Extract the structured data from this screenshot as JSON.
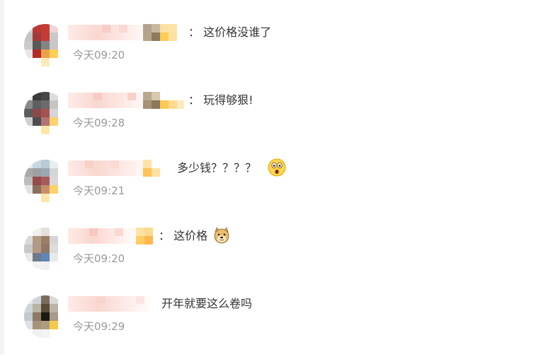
{
  "comments": [
    {
      "username": "",
      "text": "： 这价格没谁了",
      "time": "今天09:20",
      "emoji": ""
    },
    {
      "username": "",
      "text": "： 玩得够狠!",
      "time": "今天09:28",
      "emoji": ""
    },
    {
      "username": "",
      "text": "多少钱？？？？",
      "time": "今天09:21",
      "emoji": "shocked-face-icon"
    },
    {
      "username": "",
      "text": "： 这价格",
      "time": "今天09:20",
      "emoji": "doge-icon"
    },
    {
      "username": "",
      "text": "开年就要这么卷吗",
      "time": "今天09:29",
      "emoji": ""
    }
  ],
  "colors": {
    "text": "#333333",
    "timestamp": "#999999",
    "background": "#ffffff",
    "left_edge": "#f3f3f3"
  }
}
